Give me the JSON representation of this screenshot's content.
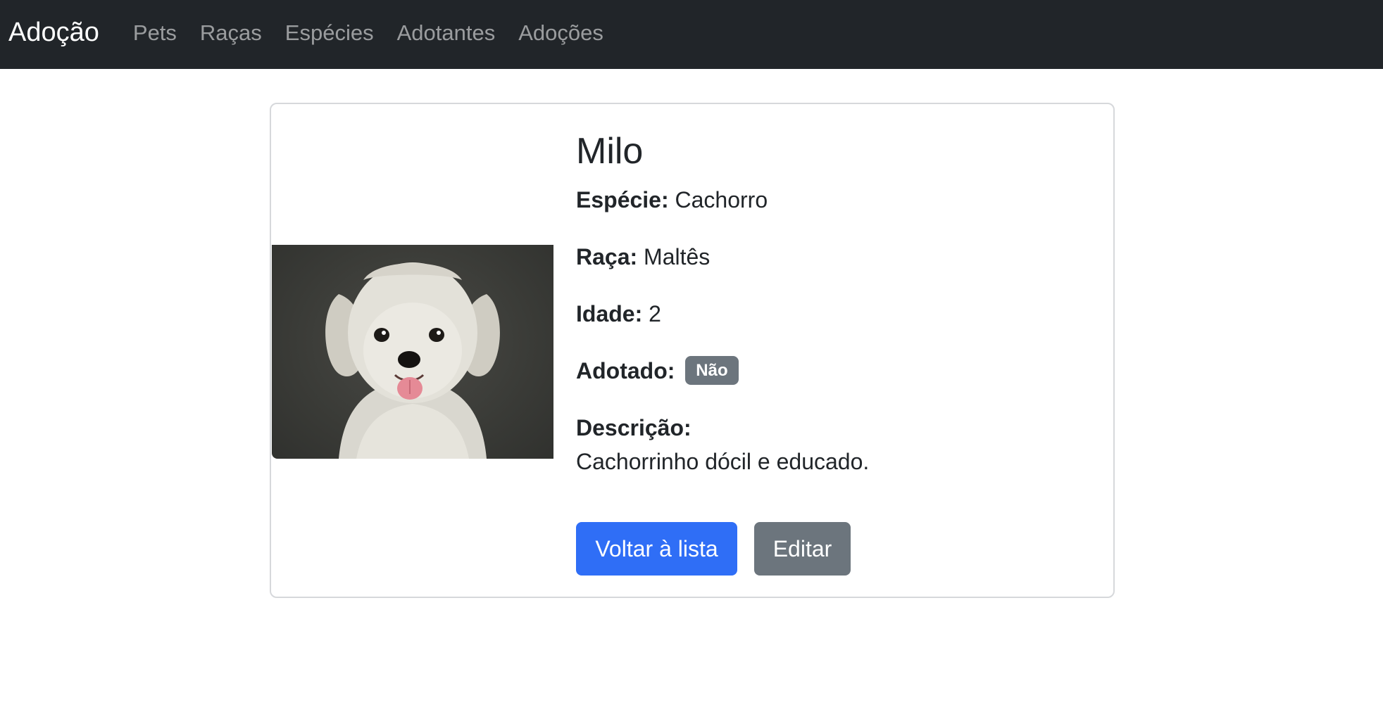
{
  "nav": {
    "brand": "Adoção",
    "links": [
      "Pets",
      "Raças",
      "Espécies",
      "Adotantes",
      "Adoções"
    ]
  },
  "pet": {
    "name": "Milo",
    "species_label": "Espécie:",
    "species": "Cachorro",
    "breed_label": "Raça:",
    "breed": "Maltês",
    "age_label": "Idade:",
    "age": "2",
    "adopted_label": "Adotado:",
    "adopted_badge": "Não",
    "description_label": "Descrição:",
    "description": "Cachorrinho dócil e educado.",
    "photo_icon": "dog-photo"
  },
  "actions": {
    "back_label": "Voltar à lista",
    "edit_label": "Editar"
  },
  "colors": {
    "navbar_bg": "#212529",
    "primary": "#2f6ef6",
    "secondary": "#6c757d"
  }
}
